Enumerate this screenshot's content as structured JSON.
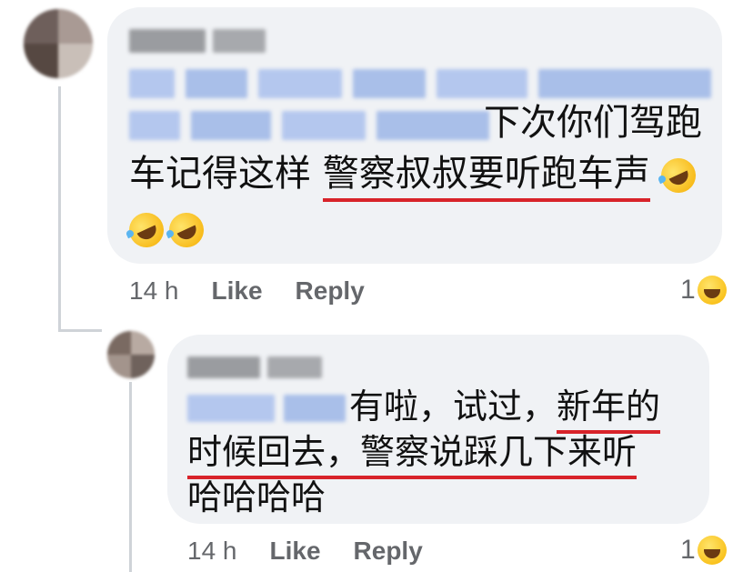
{
  "comment": {
    "text_line1": "下次你们驾跑",
    "text_line2_plain": "车记得这样 ",
    "text_line2_underlined": "警察叔叔要听跑车声",
    "emoji_main": "rolling-on-floor-laughing",
    "time": "14 h",
    "like_label": "Like",
    "reply_label": "Reply",
    "reaction_count": "1",
    "reaction_icon": "laughing-face"
  },
  "reply": {
    "text_line1_plain": "有啦，试过，",
    "text_line1_underlined": "新年的",
    "text_line2_underlined": "时候回去，警察说踩几下来听",
    "text_line3": "哈哈哈哈",
    "time": "14 h",
    "like_label": "Like",
    "reply_label": "Reply",
    "reaction_count": "1",
    "reaction_icon": "laughing-face"
  },
  "colors": {
    "bubble": "#f0f2f5",
    "meta": "#65676b",
    "underline": "#d8232a"
  }
}
